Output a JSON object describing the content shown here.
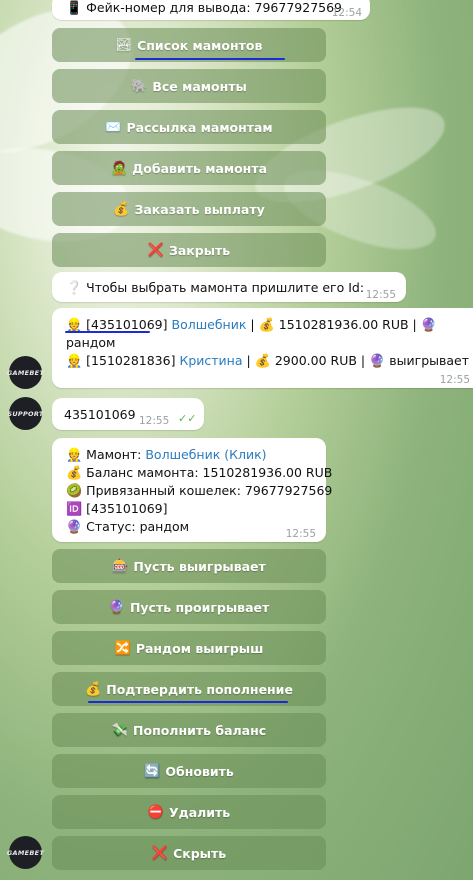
{
  "top_message": {
    "icon": "📱",
    "text": "Фейк-номер для вывода: 79677927569",
    "time": "12:54"
  },
  "keyboard_1": [
    {
      "icon": "🏞",
      "label": "Список мамонтов"
    },
    {
      "icon": "🐘",
      "label": "Все мамонты"
    },
    {
      "icon": "✉️",
      "label": "Рассылка мамонтам"
    },
    {
      "icon": "🧟",
      "label": "Добавить мамонта"
    },
    {
      "icon": "💰",
      "label": "Заказать выплату"
    },
    {
      "icon": "❌",
      "label": "Закрыть"
    }
  ],
  "prompt_message": {
    "icon": "❔",
    "text": "Чтобы выбрать мамонта пришлите его Id:",
    "time": "12:55"
  },
  "list_message": {
    "row1": {
      "icon": "👷",
      "id": "[435101069]",
      "name": "Волшебник",
      "sep1": "|",
      "money_icon": "💰",
      "balance": "1510281936.00 RUB",
      "sep2": "|",
      "status_icon": "🔮",
      "status": "рандом"
    },
    "row2": {
      "icon": "👷",
      "id": "[1510281836]",
      "name": "Кристина",
      "sep1": "|",
      "money_icon": "💰",
      "balance": "2900.00 RUB",
      "sep2": "|",
      "status_icon": "🔮",
      "status": "выигрывает"
    },
    "time": "12:55"
  },
  "my_message": {
    "text": "435101069",
    "time": "12:55",
    "checks": "✓✓"
  },
  "info_message": {
    "mammoth_label": "Мамонт:",
    "mammoth_name": "Волшебник (Клик)",
    "balance": "Баланс мамонта: 1510281936.00 RUB",
    "wallet": "Привязанный кошелек: 79677927569",
    "id": "[435101069]",
    "id_icon": "🆔",
    "status": "Статус: рандом",
    "time": "12:55"
  },
  "keyboard_2": [
    {
      "icon": "🎰",
      "label": "Пусть выигрывает"
    },
    {
      "icon": "🔮",
      "label": "Пусть проигрывает"
    },
    {
      "icon": "🔀",
      "label": "Рандом выигрыш"
    },
    {
      "icon": "💰",
      "label": "Подтвердить пополнение"
    },
    {
      "icon": "💸",
      "label": "Пополнить баланс"
    },
    {
      "icon": "🔄",
      "label": "Обновить"
    },
    {
      "icon": "⛔",
      "label": "Удалить"
    },
    {
      "icon": "❌",
      "label": "Скрыть"
    }
  ],
  "avatars": {
    "bot": "GAMEBET",
    "support": "SUPPORT"
  },
  "colors": {
    "link": "#2a7bbf",
    "button_bg": "#698c55",
    "underline": "#1b2bd6",
    "check": "#5fb35a"
  }
}
